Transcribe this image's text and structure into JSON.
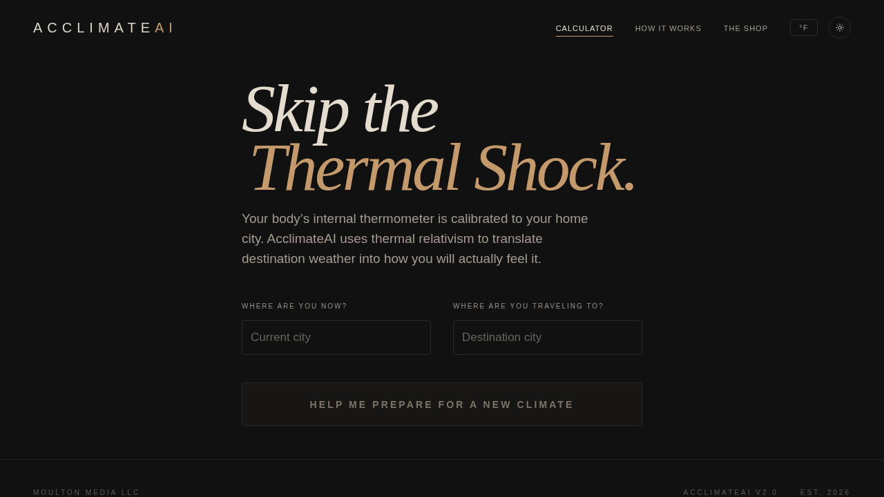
{
  "header": {
    "logo": {
      "text": "ACCLIMATE",
      "accent": "AI"
    },
    "nav": [
      {
        "label": "CALCULATOR",
        "selected": true
      },
      {
        "label": "HOW IT WORKS",
        "selected": false
      },
      {
        "label": "THE SHOP",
        "selected": false
      }
    ],
    "unit_toggle": "°F"
  },
  "hero": {
    "headline": [
      {
        "text": "Skip the",
        "accent": false
      },
      {
        "text": "Thermal Shock.",
        "accent": true
      }
    ],
    "description": "Your body’s internal thermometer is calibrated to your home city. AcclimateAI uses thermal relativism to translate destination weather into how you will actually feel it."
  },
  "form": {
    "fields": [
      {
        "label": "WHERE ARE YOU NOW?",
        "placeholder": "Current city"
      },
      {
        "label": "WHERE ARE YOU TRAVELING TO?",
        "placeholder": "Destination city"
      }
    ],
    "submit": "HELP ME PREPARE FOR A NEW CLIMATE"
  },
  "footer": {
    "company": "MOULTON MEDIA LLC",
    "version": "ACCLIMATEAI V2.0",
    "established": "EST. 2026"
  }
}
